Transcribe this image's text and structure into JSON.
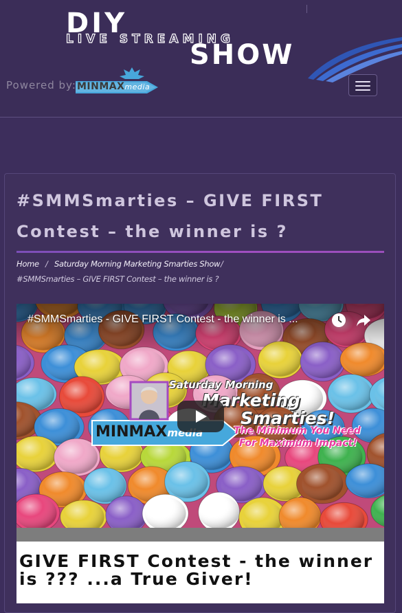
{
  "header": {
    "logo": {
      "line1": "DIY",
      "line2": "LIVE STREAMING",
      "line3": "SHOW"
    },
    "powered_by": "Powered by:",
    "sponsor": {
      "name": "MINMAX",
      "suffix": "media"
    },
    "menu_icon": "hamburger-icon"
  },
  "post": {
    "title": "#SMMSmarties – GIVE FIRST Contest – the winner is ?",
    "heading": "GIVE FIRST Contest - the winner is ??? ...a True Giver!"
  },
  "breadcrumb": {
    "items": [
      {
        "label": "Home"
      },
      {
        "label": "Saturday Morning Marketing Smarties Show"
      },
      {
        "label": "#SMMSmarties – GIVE FIRST Contest – the winner is ?"
      }
    ],
    "separator": "/"
  },
  "video": {
    "title": "#SMMSmarties - GIVE FIRST Contest - the winner is ...",
    "icons": {
      "watch_later": "clock-icon",
      "share": "share-icon",
      "play": "play-icon"
    },
    "thumbnail_text": {
      "line1": "Saturday Morning",
      "line2": "Marketing",
      "line3": "Smarties!",
      "tagline1": "The Minimum You Need",
      "tagline2": "For Maximum Impact!",
      "brand": "MINMAX",
      "brand_suffix": "media"
    }
  },
  "colors": {
    "background": "#3d2e5c",
    "title_text": "#cfc6de",
    "accent_rule": "#a04fc0",
    "tagline": "#e83a9f"
  }
}
